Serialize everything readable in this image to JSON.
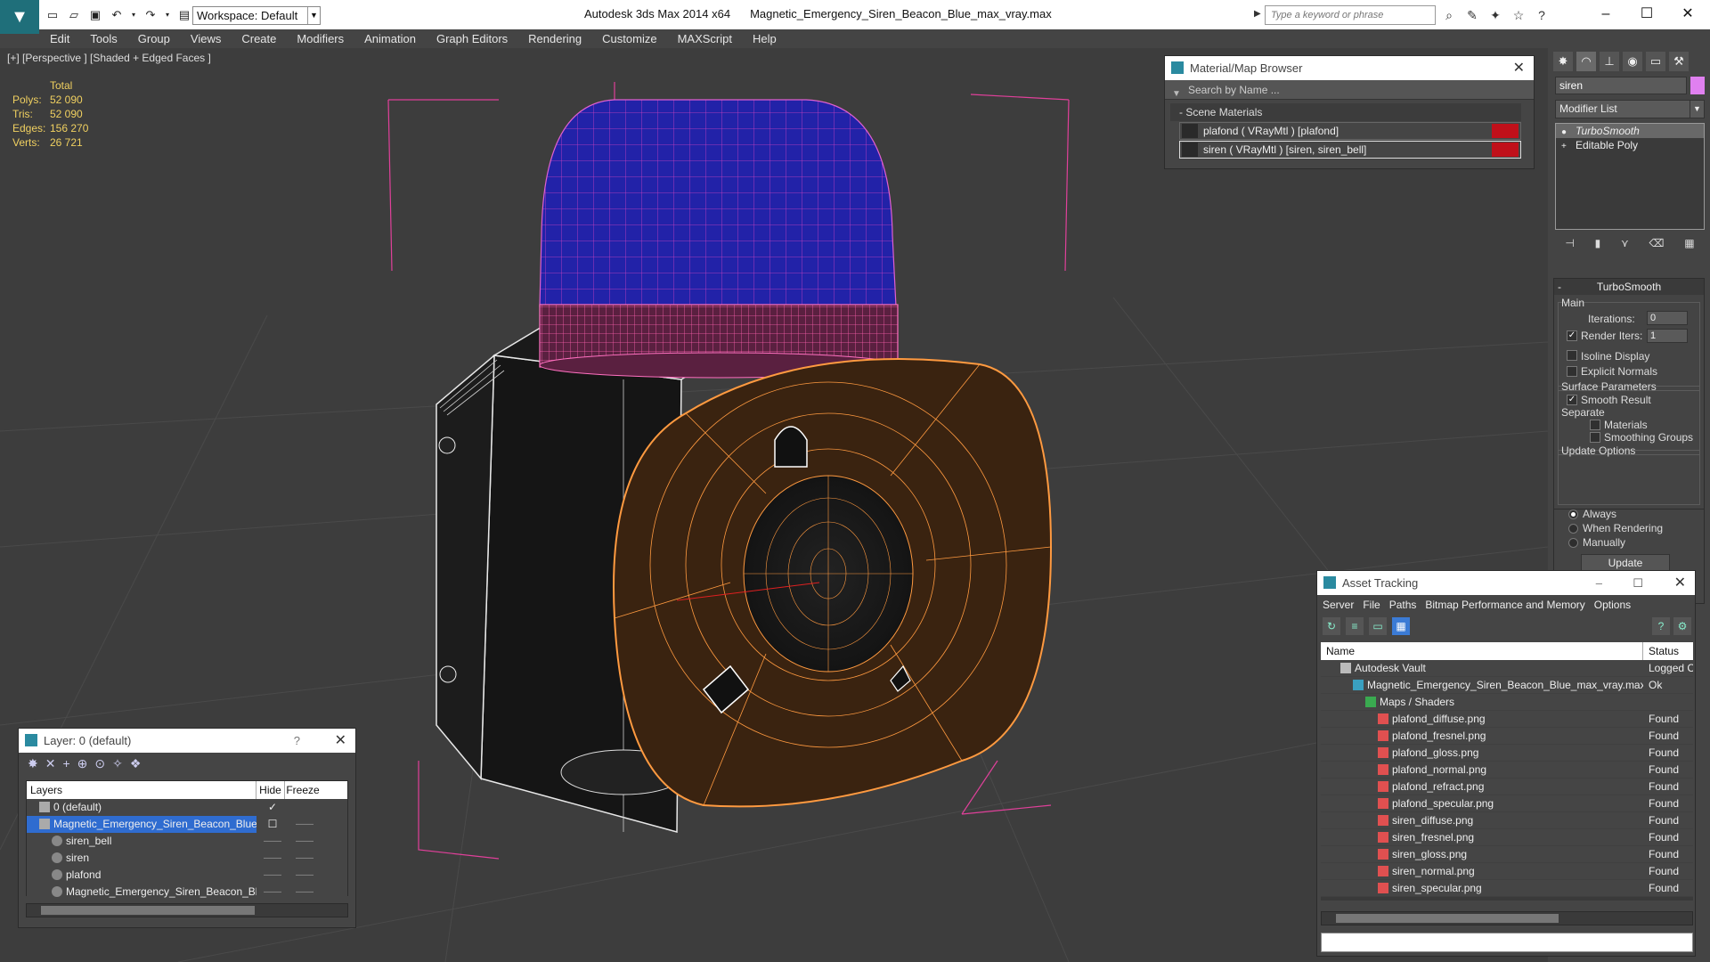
{
  "app": {
    "title": "Autodesk 3ds Max  2014 x64",
    "file": "Magnetic_Emergency_Siren_Beacon_Blue_max_vray.max",
    "workspace": "Workspace: Default",
    "search_placeholder": "Type a keyword or phrase",
    "accent_color": "#2a8aa0"
  },
  "menu": [
    "Edit",
    "Tools",
    "Group",
    "Views",
    "Create",
    "Modifiers",
    "Animation",
    "Graph Editors",
    "Rendering",
    "Customize",
    "MAXScript",
    "Help"
  ],
  "viewport": {
    "label": "[+] [Perspective ] [Shaded + Edged Faces ]",
    "stats": {
      "header": "Total",
      "polys_label": "Polys:",
      "polys": "52 090",
      "tris_label": "Tris:",
      "tris": "52 090",
      "edges_label": "Edges:",
      "edges": "156 270",
      "verts_label": "Verts:",
      "verts": "26 721"
    }
  },
  "material_browser": {
    "title": "Material/Map Browser",
    "search_placeholder": "Search by Name ...",
    "section": "- Scene Materials",
    "materials": [
      {
        "label": "plafond  ( VRayMtl )  [plafond]"
      },
      {
        "label": "siren  ( VRayMtl )  [siren, siren_bell]"
      }
    ]
  },
  "command_panel": {
    "object_name": "siren",
    "object_color": "#e080f0",
    "modifier_list": "Modifier List",
    "stack": [
      "TurboSmooth",
      "Editable Poly"
    ],
    "rollout_title": "TurboSmooth",
    "main_group": "Main",
    "iterations_label": "Iterations:",
    "iterations": "0",
    "render_iters_label": "Render Iters:",
    "render_iters": "1",
    "isoline_label": "Isoline Display",
    "explicit_normals_label": "Explicit Normals",
    "surface_group": "Surface Parameters",
    "smooth_result_label": "Smooth Result",
    "separate_label": "Separate",
    "materials_label": "Materials",
    "smoothing_groups_label": "Smoothing Groups",
    "update_group": "Update Options",
    "always_label": "Always",
    "when_rendering_label": "When Rendering",
    "manually_label": "Manually",
    "update_button": "Update"
  },
  "asset_tracking": {
    "title": "Asset Tracking",
    "menu": [
      "Server",
      "File",
      "Paths",
      "Bitmap Performance and Memory",
      "Options"
    ],
    "col_name": "Name",
    "col_status": "Status",
    "rows": [
      {
        "name": "Autodesk Vault",
        "status": "Logged C",
        "indent": 0
      },
      {
        "name": "Magnetic_Emergency_Siren_Beacon_Blue_max_vray.max",
        "status": "Ok",
        "indent": 1
      },
      {
        "name": "Maps / Shaders",
        "status": "",
        "indent": 2
      },
      {
        "name": "plafond_diffuse.png",
        "status": "Found",
        "indent": 3
      },
      {
        "name": "plafond_fresnel.png",
        "status": "Found",
        "indent": 3
      },
      {
        "name": "plafond_gloss.png",
        "status": "Found",
        "indent": 3
      },
      {
        "name": "plafond_normal.png",
        "status": "Found",
        "indent": 3
      },
      {
        "name": "plafond_refract.png",
        "status": "Found",
        "indent": 3
      },
      {
        "name": "plafond_specular.png",
        "status": "Found",
        "indent": 3
      },
      {
        "name": "siren_diffuse.png",
        "status": "Found",
        "indent": 3
      },
      {
        "name": "siren_fresnel.png",
        "status": "Found",
        "indent": 3
      },
      {
        "name": "siren_gloss.png",
        "status": "Found",
        "indent": 3
      },
      {
        "name": "siren_normal.png",
        "status": "Found",
        "indent": 3
      },
      {
        "name": "siren_specular.png",
        "status": "Found",
        "indent": 3
      }
    ]
  },
  "layer_explorer": {
    "title": "Layer: 0 (default)",
    "help": "?",
    "col_layers": "Layers",
    "col_hide": "Hide",
    "col_freeze": "Freeze",
    "rows": [
      {
        "name": "0 (default)",
        "indent": 1,
        "selected": false,
        "check": true
      },
      {
        "name": "Magnetic_Emergency_Siren_Beacon_Blue",
        "indent": 1,
        "selected": true,
        "check": false
      },
      {
        "name": "siren_bell",
        "indent": 2,
        "selected": false,
        "check": false
      },
      {
        "name": "siren",
        "indent": 2,
        "selected": false,
        "check": false
      },
      {
        "name": "plafond",
        "indent": 2,
        "selected": false,
        "check": false
      },
      {
        "name": "Magnetic_Emergency_Siren_Beacon_Blue",
        "indent": 2,
        "selected": false,
        "check": false
      }
    ]
  }
}
